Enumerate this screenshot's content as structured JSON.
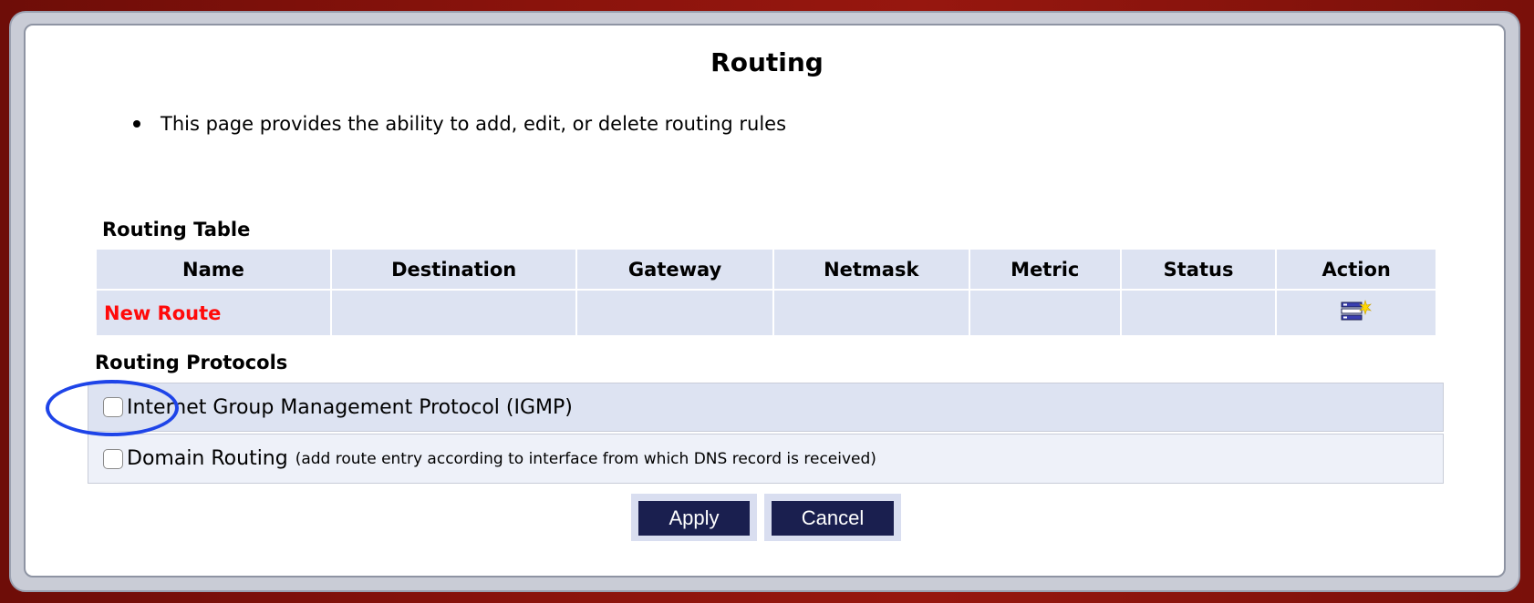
{
  "page": {
    "title": "Routing",
    "intro": "This page provides the ability to add, edit, or delete routing rules"
  },
  "routing_table": {
    "title": "Routing Table",
    "columns": [
      "Name",
      "Destination",
      "Gateway",
      "Netmask",
      "Metric",
      "Status",
      "Action"
    ],
    "rows": [
      {
        "name": "New Route",
        "destination": "",
        "gateway": "",
        "netmask": "",
        "metric": "",
        "status": "",
        "action_icon": "add-route-icon"
      }
    ]
  },
  "routing_protocols": {
    "title": "Routing Protocols",
    "items": [
      {
        "label": "Internet Group Management Protocol (IGMP)",
        "note": "",
        "checked": false
      },
      {
        "label": "Domain Routing",
        "note": "(add route entry according to interface from which DNS record is received)",
        "checked": false
      }
    ]
  },
  "buttons": {
    "apply": "Apply",
    "cancel": "Cancel"
  },
  "colors": {
    "header_bg": "#dde3f2",
    "new_route": "#ff0a0a",
    "button_bg": "#1a1f4f",
    "highlight": "#1e44e8"
  }
}
